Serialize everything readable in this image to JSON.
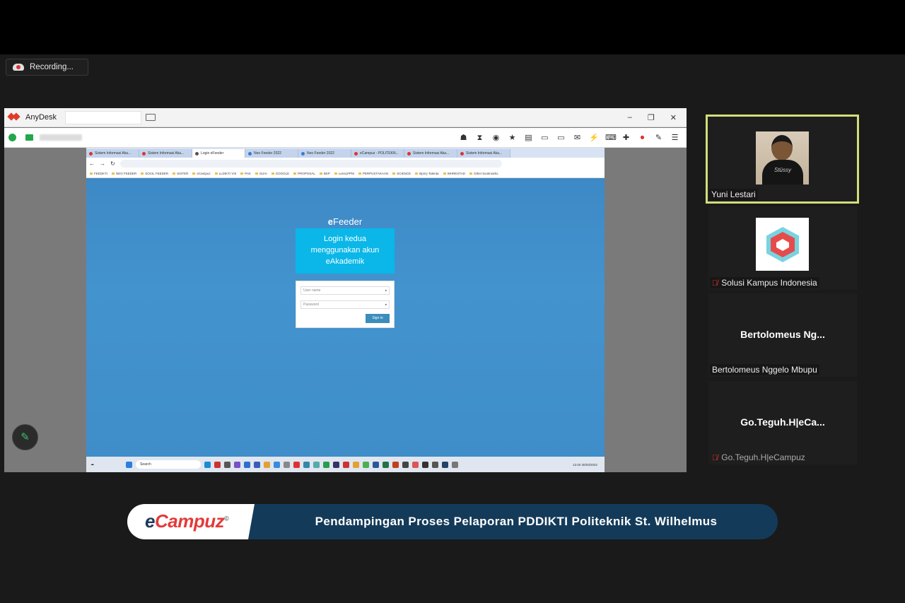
{
  "recording": {
    "label": "Recording..."
  },
  "anydesk": {
    "app_name": "AnyDesk",
    "window_controls": [
      "–",
      "❐",
      "✕"
    ],
    "toolbar_icons": [
      "user-icon",
      "hourglass-icon",
      "disk-icon",
      "star-icon",
      "file-icon",
      "chat-icon",
      "monitor-icon",
      "message-icon",
      "lightning-icon",
      "keyboard-icon",
      "plus-icon",
      "record-icon",
      "pen-icon",
      "menu-icon"
    ]
  },
  "remote_browser": {
    "tabs": [
      {
        "label": "Sistem Informasi Aka...",
        "active": false
      },
      {
        "label": "Sistem Informasi Aka...",
        "active": false
      },
      {
        "label": "Login eFeeder",
        "active": true
      },
      {
        "label": "Neo Feeder 2022",
        "active": false
      },
      {
        "label": "Neo Feeder 2022",
        "active": false
      },
      {
        "label": "eCampuz - POLITEKN...",
        "active": false
      },
      {
        "label": "Sistem Informasi Aka...",
        "active": false
      },
      {
        "label": "Sistem Informasi Aka...",
        "active": false
      }
    ],
    "bookmarks": [
      "FEEDKTI",
      "NEO FEEDER",
      "SOCIL FEEDER",
      "SISTER",
      "eCampuz",
      "LLDIKTI VIII",
      "PAK",
      "SIJAI",
      "GOOGLE",
      "PROPOSAL",
      "BKP",
      "LensLPPM",
      "PERPUSTAKAAN",
      "SCIENCE",
      "Bpnry Talenta",
      "WHRESTAD",
      "Other bookmarks"
    ],
    "login": {
      "brand_prefix": "e",
      "brand_rest": "Feeder",
      "panel_line1": "Login kedua",
      "panel_line2": "menggunakan akun",
      "panel_line3": "eAkademik",
      "username_placeholder": "User name",
      "password_placeholder": "Password",
      "signin_label": "Sign in"
    },
    "taskbar": {
      "search_label": "Search",
      "time": "13:40",
      "date": "30/03/2022"
    }
  },
  "participants": [
    {
      "name": "Yuni Lestari",
      "active": true,
      "muted": false
    },
    {
      "name": "Solusi Kampus Indonesia",
      "muted": true
    },
    {
      "name": "Bertolomeus Nggelo Mbupu",
      "display": "Bertolomeus  Ng...",
      "muted": false
    },
    {
      "name": "Go.Teguh.H|eCampuz",
      "display": "Go.Teguh.H|eCa...",
      "muted": true
    }
  ],
  "banner": {
    "logo_e": "e",
    "logo_rest": "Campuz",
    "logo_mark": "©",
    "title": "Pendampingan Proses Pelaporan PDDIKTI Politeknik St. Wilhelmus"
  },
  "colors": {
    "accent_active_speaker": "#d3de79",
    "efeeder_panel": "#0ab7e8",
    "banner_bg": "#143a59",
    "brand_red": "#e43a3a"
  }
}
